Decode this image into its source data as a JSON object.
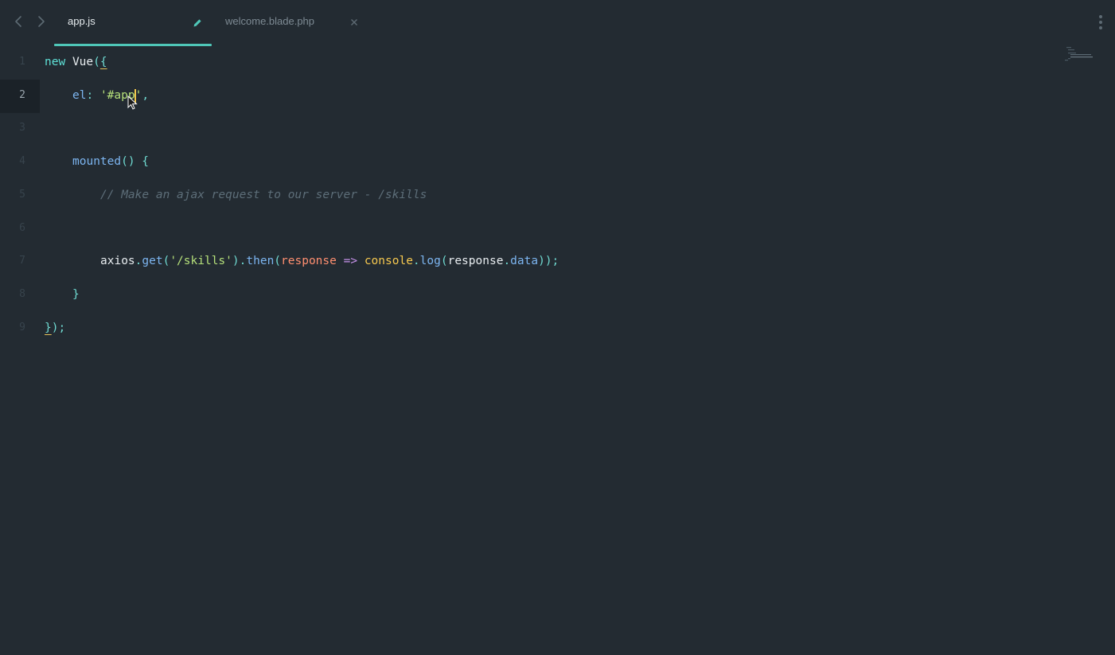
{
  "tabs": [
    {
      "label": "app.js",
      "active": true,
      "modified": true
    },
    {
      "label": "welcome.blade.php",
      "active": false,
      "modified": false
    }
  ],
  "icons": {
    "back": "chevron-left-icon",
    "forward": "chevron-right-icon",
    "modified": "pencil-icon",
    "close": "close-icon",
    "more": "more-vertical-icon"
  },
  "colors": {
    "background": "#232b32",
    "accent": "#4fc7b8",
    "caret": "#f2c84b"
  },
  "editor": {
    "current_line": 2,
    "lines": [
      {
        "num": "1",
        "tokens": [
          {
            "t": "new",
            "c": "kw"
          },
          {
            "t": " ",
            "c": "id"
          },
          {
            "t": "Vue",
            "c": "id"
          },
          {
            "t": "(",
            "c": "pun"
          },
          {
            "t": "{",
            "c": "brace-match"
          }
        ]
      },
      {
        "num": "2",
        "tokens": [
          {
            "t": "el",
            "c": "prop"
          },
          {
            "t": ": ",
            "c": "pun"
          },
          {
            "t": "'",
            "c": "str"
          },
          {
            "t": "#app",
            "c": "str"
          },
          {
            "t": "'",
            "c": "str"
          },
          {
            "t": ",",
            "c": "pun"
          }
        ]
      },
      {
        "num": "3",
        "tokens": []
      },
      {
        "num": "4",
        "tokens": [
          {
            "t": "mounted",
            "c": "fn"
          },
          {
            "t": "() {",
            "c": "pun"
          }
        ]
      },
      {
        "num": "5",
        "tokens": [
          {
            "t": "// Make an ajax request to our server - /skills",
            "c": "cmt"
          }
        ]
      },
      {
        "num": "6",
        "tokens": []
      },
      {
        "num": "7",
        "tokens": [
          {
            "t": "axios",
            "c": "id"
          },
          {
            "t": ".",
            "c": "pun"
          },
          {
            "t": "get",
            "c": "fn"
          },
          {
            "t": "(",
            "c": "pun"
          },
          {
            "t": "'/skills'",
            "c": "str"
          },
          {
            "t": ")",
            "c": "pun"
          },
          {
            "t": ".",
            "c": "pun"
          },
          {
            "t": "then",
            "c": "fn"
          },
          {
            "t": "(",
            "c": "pun"
          },
          {
            "t": "response",
            "c": "param"
          },
          {
            "t": " ",
            "c": "id"
          },
          {
            "t": "=>",
            "c": "op"
          },
          {
            "t": " ",
            "c": "id"
          },
          {
            "t": "console",
            "c": "obj"
          },
          {
            "t": ".",
            "c": "pun"
          },
          {
            "t": "log",
            "c": "fn"
          },
          {
            "t": "(",
            "c": "pun"
          },
          {
            "t": "response",
            "c": "id"
          },
          {
            "t": ".",
            "c": "pun"
          },
          {
            "t": "data",
            "c": "prop"
          },
          {
            "t": "));",
            "c": "pun"
          }
        ]
      },
      {
        "num": "8",
        "tokens": [
          {
            "t": "}",
            "c": "pun"
          }
        ]
      },
      {
        "num": "9",
        "tokens": [
          {
            "t": "}",
            "c": "brace-match"
          },
          {
            "t": ");",
            "c": "pun"
          }
        ]
      }
    ]
  }
}
